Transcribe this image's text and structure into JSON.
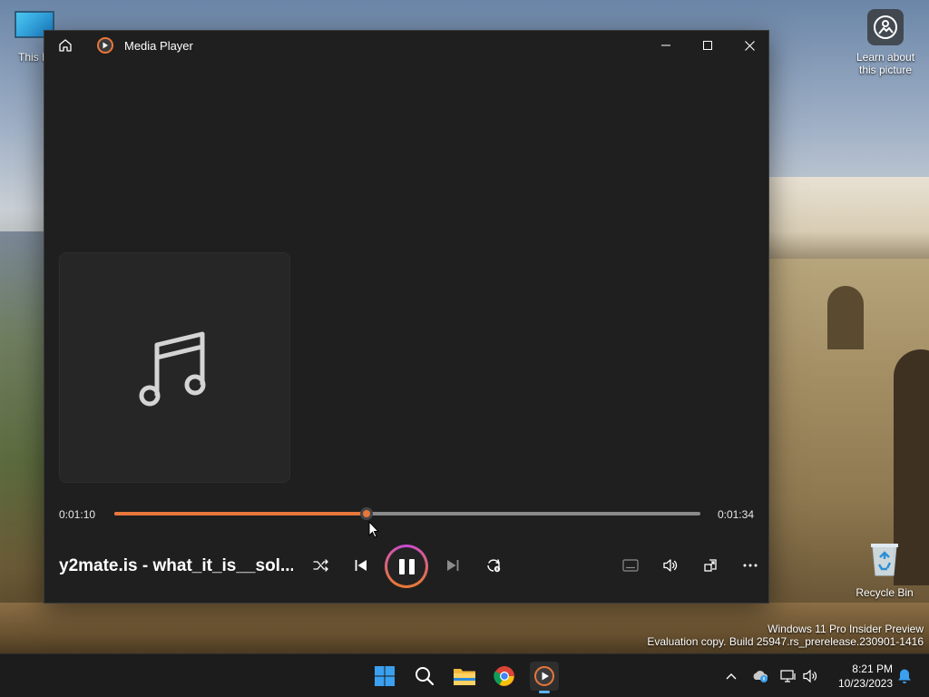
{
  "desktop": {
    "icons": [
      {
        "label": "This P"
      },
      {
        "label": "Learn about this picture"
      },
      {
        "label": "Recycle Bin"
      }
    ],
    "watermark": {
      "line1": "Windows 11 Pro Insider Preview",
      "line2": "Evaluation copy. Build 25947.rs_prerelease.230901-1416"
    }
  },
  "window": {
    "title": "Media Player",
    "controls": {
      "minimize": "minimize",
      "maximize": "maximize",
      "close": "close"
    }
  },
  "player": {
    "track_title": "y2mate.is - what_it_is__sol...",
    "current_time": "0:01:10",
    "total_time": "0:01:34",
    "progress_fraction": 0.43,
    "accent_color": "#e8773b",
    "controls": [
      {
        "name": "shuffle",
        "icon": "shuffle-icon"
      },
      {
        "name": "previous",
        "icon": "previous-icon"
      },
      {
        "name": "play-pause",
        "icon": "pause-icon"
      },
      {
        "name": "next",
        "icon": "next-icon"
      },
      {
        "name": "repeat",
        "icon": "repeat-icon"
      },
      {
        "name": "captions",
        "icon": "captions-icon"
      },
      {
        "name": "volume",
        "icon": "volume-icon"
      },
      {
        "name": "mini-player",
        "icon": "mini-player-icon"
      },
      {
        "name": "more",
        "icon": "more-icon"
      }
    ]
  },
  "taskbar": {
    "apps": [
      "start",
      "search",
      "file-explorer",
      "chrome",
      "media-player"
    ],
    "time": "8:21 PM",
    "date": "10/23/2023"
  }
}
